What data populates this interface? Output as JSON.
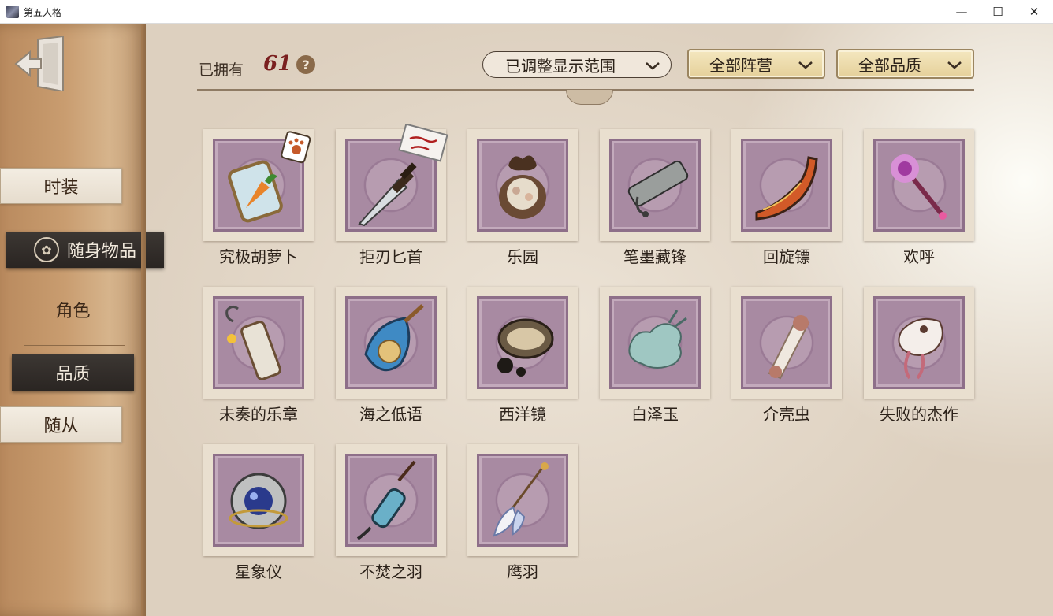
{
  "window": {
    "title": "第五人格",
    "minimize_glyph": "—",
    "maximize_glyph": "☐",
    "close_glyph": "✕"
  },
  "sidebar": {
    "tabs": [
      {
        "label": "时装"
      },
      {
        "label": "随身物品"
      },
      {
        "label": "角色"
      },
      {
        "label": "品质"
      },
      {
        "label": "随从"
      }
    ]
  },
  "header": {
    "owned_label": "已拥有",
    "owned_count": "61",
    "help_glyph": "?",
    "range_filter": "已调整显示范围",
    "camp_filter": "全部阵营",
    "quality_filter": "全部品质"
  },
  "items": [
    {
      "name": "究极胡萝卜",
      "icon": "carrot-jar-icon",
      "badge": "paw-tag-icon"
    },
    {
      "name": "拒刃匕首",
      "icon": "dagger-icon",
      "badge": "angels-of-death-sign-icon"
    },
    {
      "name": "乐园",
      "icon": "paradise-orb-icon"
    },
    {
      "name": "笔墨藏锋",
      "icon": "ink-brush-icon"
    },
    {
      "name": "回旋镖",
      "icon": "boomerang-icon"
    },
    {
      "name": "欢呼",
      "icon": "cheer-wand-icon"
    },
    {
      "name": "未奏的乐章",
      "icon": "scroll-hook-icon"
    },
    {
      "name": "海之低语",
      "icon": "sea-shell-icon"
    },
    {
      "name": "西洋镜",
      "icon": "kaleidoscope-icon"
    },
    {
      "name": "白泽玉",
      "icon": "baize-jade-icon"
    },
    {
      "name": "介壳虫",
      "icon": "scale-insect-icon"
    },
    {
      "name": "失败的杰作",
      "icon": "failed-masterpiece-icon"
    },
    {
      "name": "星象仪",
      "icon": "astrolabe-icon"
    },
    {
      "name": "不焚之羽",
      "icon": "unburnt-feather-icon"
    },
    {
      "name": "鹰羽",
      "icon": "eagle-feather-icon"
    }
  ],
  "colors": {
    "accent_count": "#7a1f1f",
    "stamp_purple": "#a88aa2",
    "sidebar_wood": "#c99d70",
    "active_tab": "#2a2522"
  }
}
